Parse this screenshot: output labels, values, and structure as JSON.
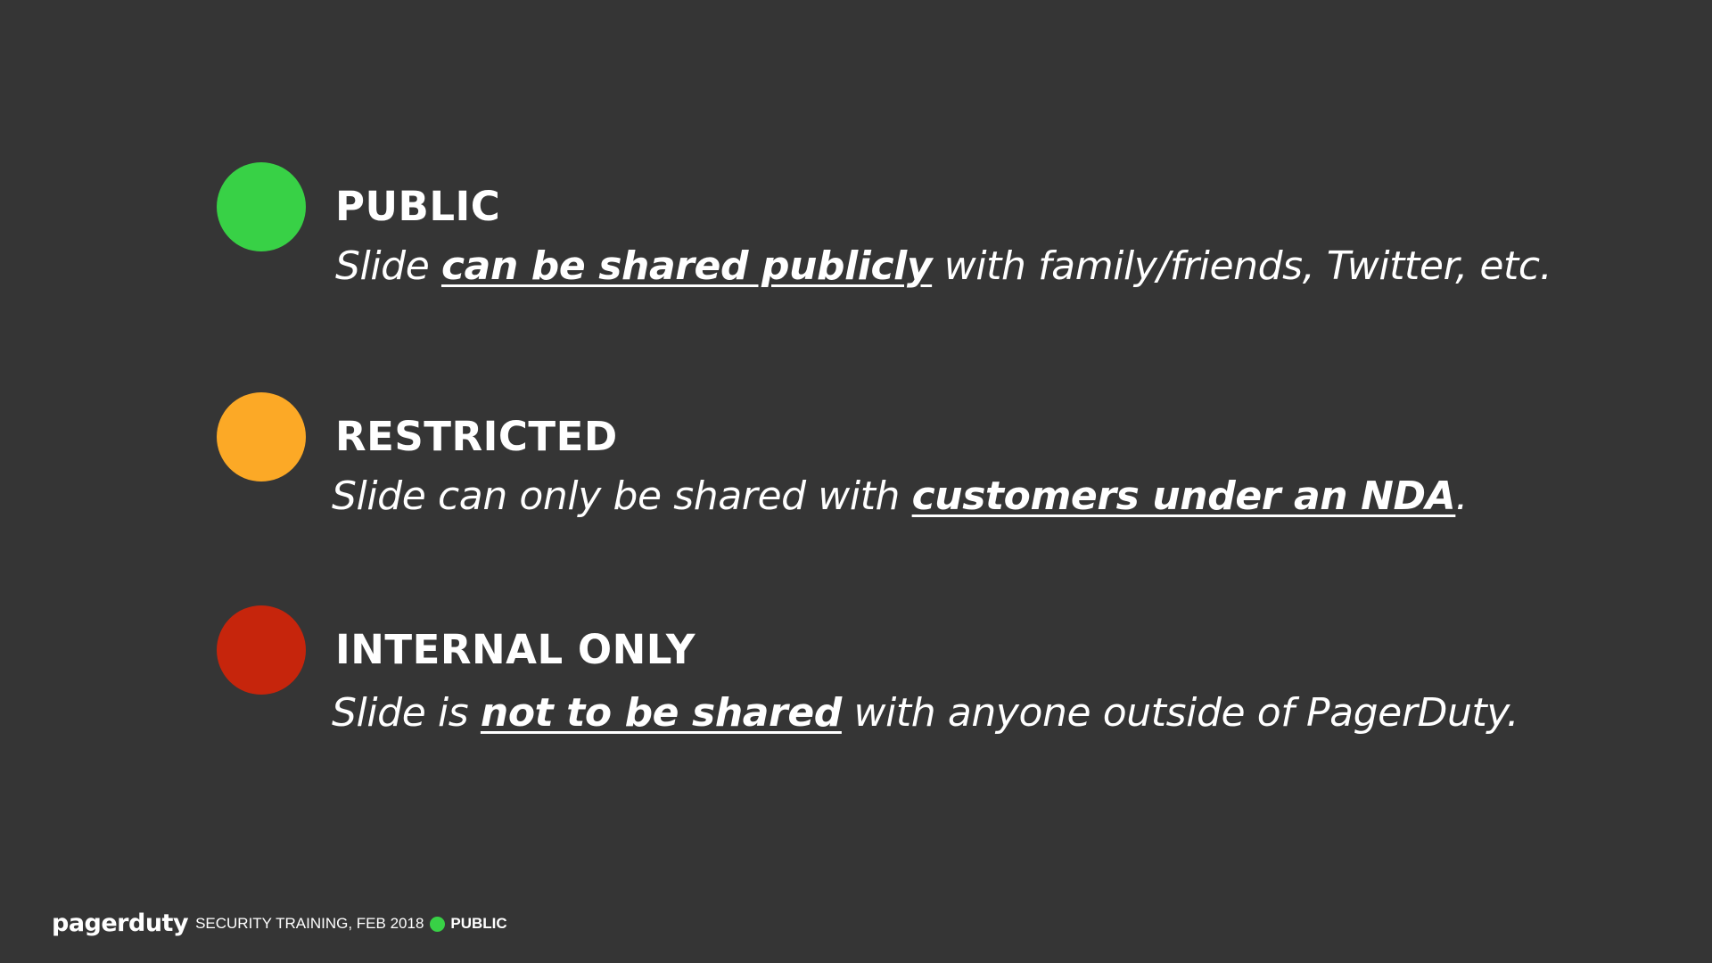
{
  "colors": {
    "background": "#353535",
    "public": "#38d146",
    "restricted": "#fca926",
    "internal": "#c6250c"
  },
  "levels": [
    {
      "title": "PUBLIC",
      "desc_pre": "Slide ",
      "desc_emph": "can be shared publicly",
      "desc_post": " with family/friends, Twitter, etc.",
      "color": "#38d146"
    },
    {
      "title": "RESTRICTED",
      "desc_pre": "Slide can only be shared with ",
      "desc_emph": "customers under an NDA",
      "desc_post": ".",
      "color": "#fca926"
    },
    {
      "title": "INTERNAL ONLY",
      "desc_pre": "Slide is ",
      "desc_emph": "not to be shared",
      "desc_post": " with anyone outside of PagerDuty.",
      "color": "#c6250c"
    }
  ],
  "footer": {
    "logo": "pagerduty",
    "text": "SECURITY TRAINING, FEB 2018",
    "classification": "PUBLIC",
    "classification_color": "#38d146"
  }
}
